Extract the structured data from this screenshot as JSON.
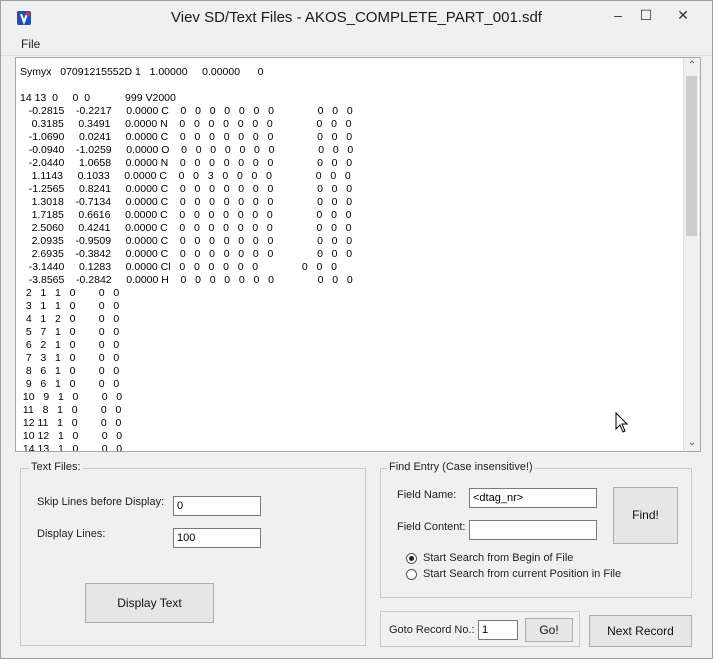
{
  "window": {
    "title": "Viev SD/Text Files - AKOS_COMPLETE_PART_001.sdf",
    "icon": "app-icon",
    "buttons": {
      "minimize": "–",
      "maximize": "☐",
      "close": "✕"
    }
  },
  "menu": {
    "file": "File"
  },
  "text_lines": [
    "Symyx   07091215552D 1   1.00000     0.00000      0",
    "",
    "14 13  0     0  0            999 V2000",
    "   -0.2815    -0.2217     0.0000 C    0   0   0   0   0   0   0               0   0   0",
    "    0.3185     0.3491     0.0000 N    0   0   0   0   0   0   0               0   0   0",
    "   -1.0690     0.0241     0.0000 C    0   0   0   0   0   0   0               0   0   0",
    "   -0.0940    -1.0259     0.0000 O    0   0   0   0   0   0   0               0   0   0",
    "   -2.0440     1.0658     0.0000 N    0   0   0   0   0   0   0               0   0   0",
    "    1.1143     0.1033     0.0000 C    0   0   3   0   0   0   0               0   0   0",
    "   -1.2565     0.8241     0.0000 C    0   0   0   0   0   0   0               0   0   0",
    "    1.3018    -0.7134     0.0000 C    0   0   0   0   0   0   0               0   0   0",
    "    1.7185     0.6616     0.0000 C    0   0   0   0   0   0   0               0   0   0",
    "    2.5060     0.4241     0.0000 C    0   0   0   0   0   0   0               0   0   0",
    "    2.0935    -0.9509     0.0000 C    0   0   0   0   0   0   0               0   0   0",
    "    2.6935    -0.3842     0.0000 C    0   0   0   0   0   0   0               0   0   0",
    "   -3.1440     0.1283     0.0000 Cl   0   0   0   0   0   0               0   0   0",
    "   -3.8565    -0.2842     0.0000 H    0   0   0   0   0   0   0               0   0   0",
    "  2   1   1   0        0   0",
    "  3   1   1   0        0   0",
    "  4   1   2   0        0   0",
    "  5   7   1   0        0   0",
    "  6   2   1   0        0   0",
    "  7   3   1   0        0   0",
    "  8   6   1   0        0   0",
    "  9   6   1   0        0   0",
    " 10   9   1   0        0   0",
    " 11   8   1   0        0   0",
    " 12 11   1   0        0   0",
    " 10 12   1   0        0   0",
    " 14 13   1   0        0   0"
  ],
  "text_files": {
    "legend": "Text Files:",
    "skip_label": "Skip Lines before Display:",
    "skip_value": "0",
    "display_label": "Display Lines:",
    "display_value": "100",
    "display_button": "Display Text"
  },
  "find": {
    "legend": "Find Entry (Case insensitive!)",
    "field_name_label": "Field Name:",
    "field_name_value": "<dtag_nr>",
    "field_content_label": "Field Content:",
    "field_content_value": "",
    "find_button": "Find!",
    "radio_begin": "Start Search from Begin of File",
    "radio_current": "Start Search from current Position in File",
    "selected": "begin"
  },
  "goto": {
    "label": "Goto Record No.:",
    "value": "1",
    "go_button": "Go!",
    "next_button": "Next Record"
  }
}
